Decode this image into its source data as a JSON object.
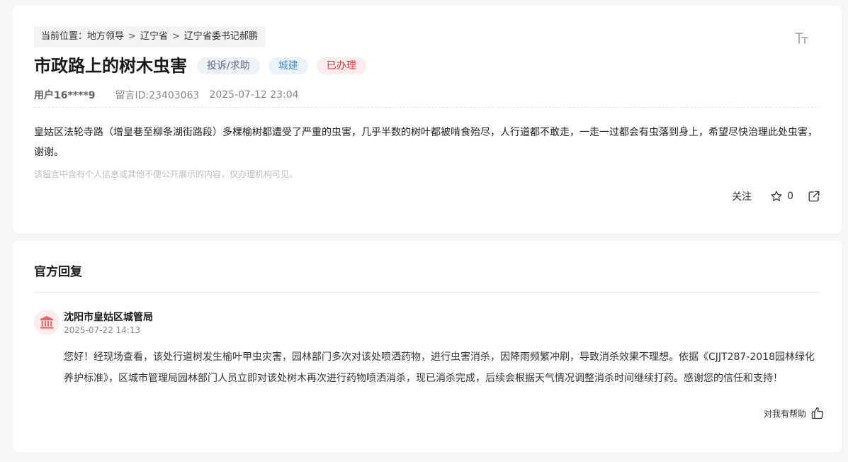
{
  "breadcrumb": {
    "prefix": "当前位置：",
    "items": [
      "地方领导",
      "辽宁省",
      "辽宁省委书记郝鹏"
    ],
    "separator": ">"
  },
  "post": {
    "title": "市政路上的树木虫害",
    "tags": {
      "type": "投诉/求助",
      "category": "城建",
      "status": "已办理"
    },
    "user": "用户16****9",
    "message_id": "留言ID:23403063",
    "datetime": "2025-07-12 23:04",
    "content": "皇姑区法轮寺路（增皇巷至柳条湖街路段）多棵榆树都遭受了严重的虫害，几乎半数的树叶都被啃食殆尽，人行道都不敢走，一走一过都会有虫落到身上，希望尽快治理此处虫害，谢谢。",
    "privacy_note": "该留言中含有个人信息或其他不便公开展示的内容，仅办理机构可见。",
    "actions": {
      "follow_label": "关注",
      "star_count": "0"
    },
    "icons": {
      "font_size": "font-size-icon",
      "star": "star-icon",
      "share": "share-icon"
    }
  },
  "reply": {
    "section_title": "官方回复",
    "org_name": "沈阳市皇姑区城管局",
    "datetime": "2025-07-22 14:13",
    "content": "您好！经现场查看，该处行道树发生榆叶甲虫灾害，园林部门多次对该处喷洒药物，进行虫害消杀，因降雨频繁冲刷，导致消杀效果不理想。依据《CJJT287-2018园林绿化养护标准》，区城市管理局园林部门人员立即对该处树木再次进行药物喷洒消杀，现已消杀完成，后续会根据天气情况调整消杀时间继续打药。感谢您的信任和支持！",
    "helpful_label": "对我有帮助",
    "icons": {
      "org": "government-building-icon",
      "helpful": "thumbs-up-icon"
    }
  },
  "colors": {
    "page_bg": "#f5f6f8",
    "tag_type_text": "#5c6b8a",
    "tag_category_text": "#4b8ed0",
    "tag_status_text": "#d9363e",
    "org_icon": "#e06a6a"
  }
}
